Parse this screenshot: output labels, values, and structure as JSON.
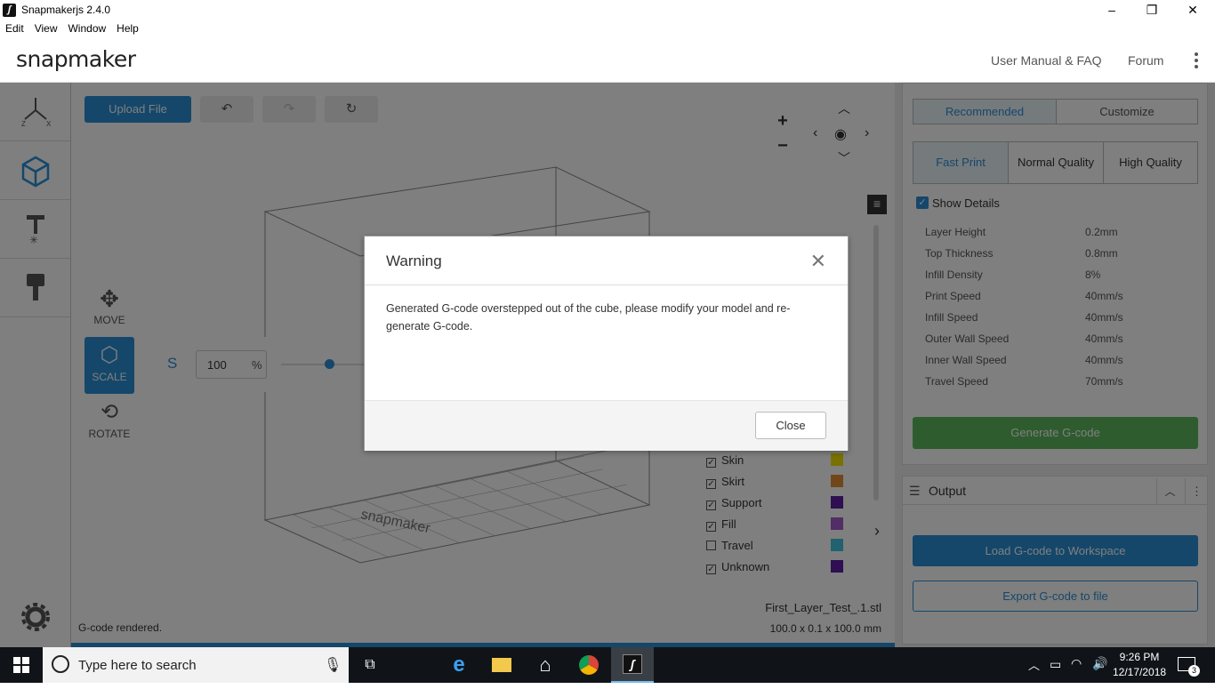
{
  "window": {
    "title": "Snapmakerjs 2.4.0",
    "minimize": "–",
    "maximize": "❐",
    "close": "✕"
  },
  "menu": [
    "Edit",
    "View",
    "Window",
    "Help"
  ],
  "header": {
    "logo": "snapmaker",
    "links": [
      "User Manual & FAQ",
      "Forum"
    ]
  },
  "sidebar": {
    "items": [
      "axes-icon",
      "cube-icon",
      "laser-icon",
      "cnc-icon"
    ],
    "settings_icon": "gear-icon"
  },
  "workspace": {
    "upload_label": "Upload File",
    "tools": [
      {
        "label": "MOVE"
      },
      {
        "label": "SCALE"
      },
      {
        "label": "ROTATE"
      }
    ],
    "scale": {
      "axis": "S",
      "value": "100",
      "unit": "%"
    },
    "zoom_in": "+",
    "zoom_out": "−",
    "status": "G-code rendered.",
    "file_name": "First_Layer_Test_.1.stl",
    "dimensions": "100.0 x 0.1 x 100.0 mm",
    "bed_logo": "snapmaker",
    "legend": [
      {
        "label": "Skin",
        "checked": true,
        "color": "#f2e500"
      },
      {
        "label": "Skirt",
        "checked": true,
        "color": "#e28f35"
      },
      {
        "label": "Support",
        "checked": true,
        "color": "#5a1fa5"
      },
      {
        "label": "Fill",
        "checked": true,
        "color": "#a55acd"
      },
      {
        "label": "Travel",
        "checked": false,
        "color": "#43c2e0"
      },
      {
        "label": "Unknown",
        "checked": true,
        "color": "#5a1fa5"
      }
    ]
  },
  "rightpanel": {
    "tabs": [
      "Recommended",
      "Customize"
    ],
    "qualities": [
      "Fast Print",
      "Normal Quality",
      "High Quality"
    ],
    "show_details": "Show Details",
    "params": [
      {
        "label": "Layer Height",
        "value": "0.2mm"
      },
      {
        "label": "Top Thickness",
        "value": "0.8mm"
      },
      {
        "label": "Infill Density",
        "value": "8%"
      },
      {
        "label": "Print Speed",
        "value": "40mm/s"
      },
      {
        "label": "Infill Speed",
        "value": "40mm/s"
      },
      {
        "label": "Outer Wall Speed",
        "value": "40mm/s"
      },
      {
        "label": "Inner Wall Speed",
        "value": "40mm/s"
      },
      {
        "label": "Travel Speed",
        "value": "70mm/s"
      }
    ],
    "generate_label": "Generate G-code",
    "output_title": "Output",
    "load_label": "Load G-code to Workspace",
    "export_label": "Export G-code to file"
  },
  "dialog": {
    "title": "Warning",
    "message": "Generated G-code overstepped out of the cube, please modify your model and re-generate G-code.",
    "close_label": "Close"
  },
  "taskbar": {
    "search_placeholder": "Type here to search",
    "time": "9:26 PM",
    "date": "12/17/2018",
    "notifications": "3"
  },
  "colors": {
    "accent": "#2a8fd4",
    "generate": "#5cb85c",
    "overlay": "rgba(0,0,0,0.5)"
  }
}
